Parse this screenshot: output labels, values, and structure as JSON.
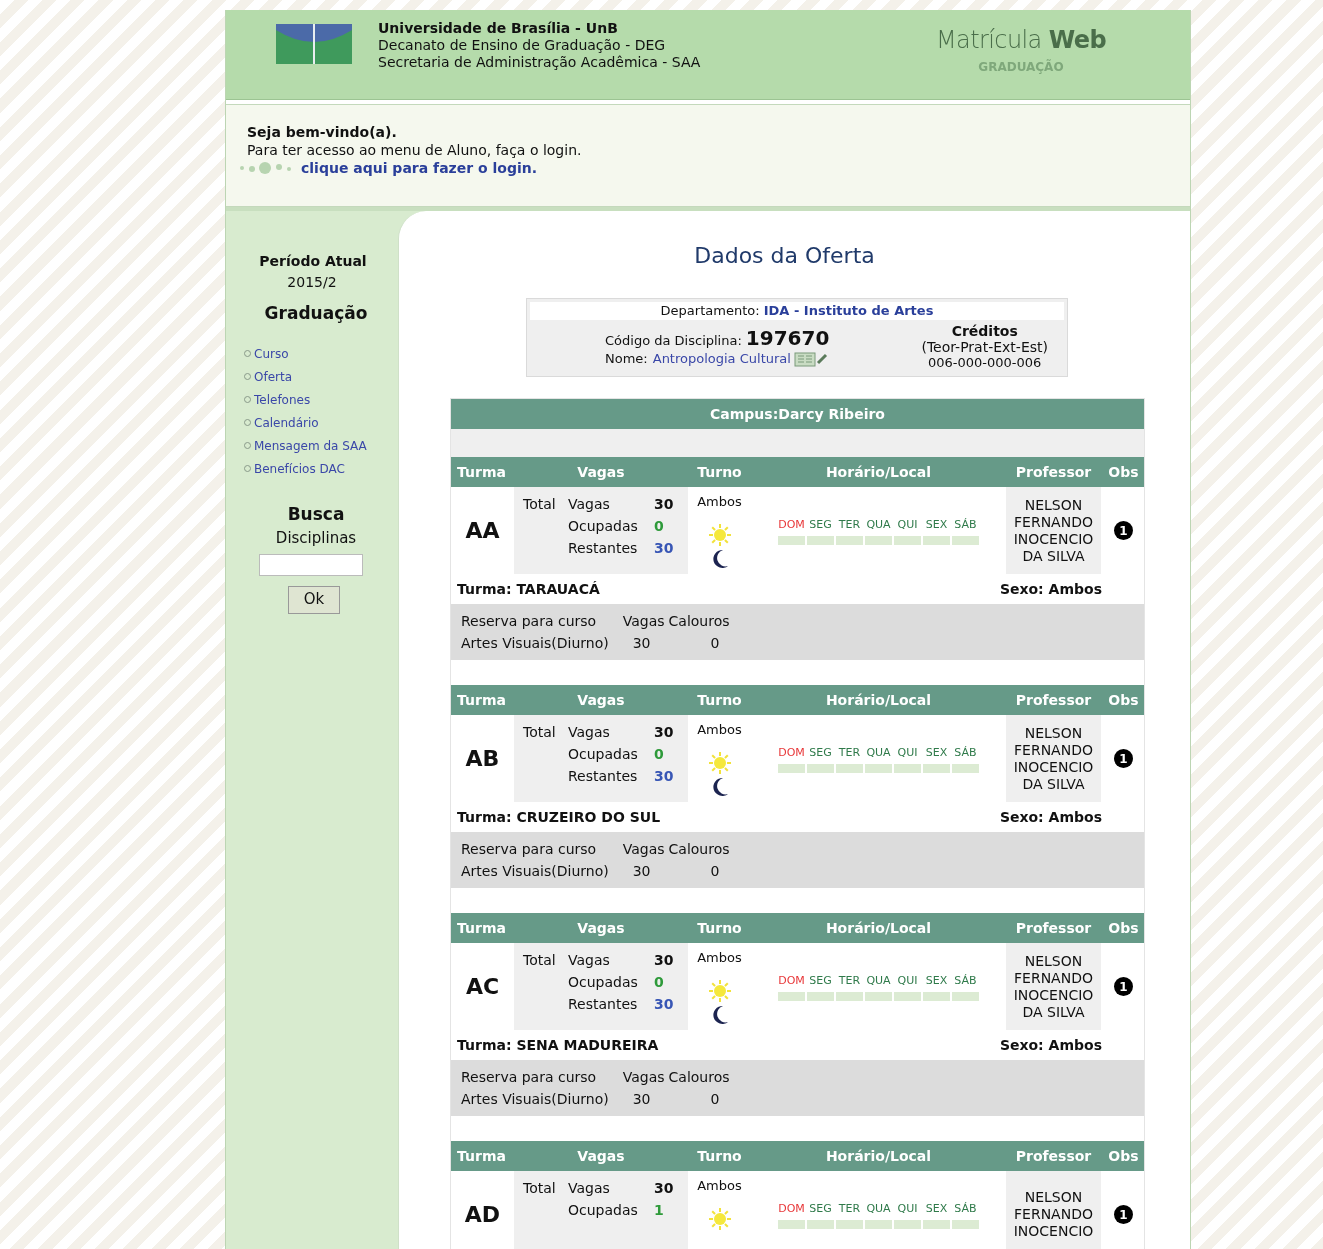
{
  "header": {
    "lines": [
      "Universidade de Brasília - UnB",
      "Decanato de Ensino de Graduação - DEG",
      "Secretaria de Administração Acadêmica - SAA"
    ],
    "brand_light": "Matrícula",
    "brand_bold": "Web",
    "brand_sub": "GRADUAÇÃO"
  },
  "welcome": {
    "title": "Seja bem-vindo(a).",
    "text": "Para ter acesso ao menu de Aluno, faça o login.",
    "link": "clique aqui para fazer o login."
  },
  "sidebar": {
    "period_label": "Período Atual",
    "period": "2015/2",
    "section": "Graduação",
    "items": [
      {
        "label": "Curso"
      },
      {
        "label": "Oferta"
      },
      {
        "label": "Telefones"
      },
      {
        "label": "Calendário"
      },
      {
        "label": "Mensagem da SAA"
      },
      {
        "label": "Benefícios DAC"
      }
    ],
    "search_title": "Busca",
    "search_sub": "Disciplinas",
    "search_button": "Ok"
  },
  "main": {
    "title": "Dados da Oferta",
    "dept_label": "Departamento:",
    "dept": "IDA - Instituto de Artes",
    "code_label": "Código da Disciplina:",
    "code": "197670",
    "name_label": "Nome:",
    "name": "Antropologia Cultural",
    "credits_title": "Créditos",
    "credits_sub": "(Teor-Prat-Ext-Est)",
    "credits": "006-000-000-006",
    "campus": "Campus:Darcy Ribeiro",
    "turmas": [
      {
        "columns": [
          "Turma",
          "Vagas",
          "Turno",
          "Horário/Local",
          "Professor",
          "Obs"
        ],
        "code": "AA",
        "total": "Total",
        "vagas_label": "Vagas",
        "vagas": "30",
        "ocupadas_label": "Ocupadas",
        "ocupadas": "0",
        "restantes_label": "Restantes",
        "restantes": "30",
        "turno": "Ambos",
        "sun": true,
        "moon": true,
        "days": [
          {
            "label": "DOM",
            "color": "#e8383a"
          },
          {
            "label": "SEG",
            "color": "#2f7a4a"
          },
          {
            "label": "TER",
            "color": "#2f7a4a"
          },
          {
            "label": "QUA",
            "color": "#2f7a4a"
          },
          {
            "label": "QUI",
            "color": "#2f7a4a"
          },
          {
            "label": "SEX",
            "color": "#2f7a4a"
          },
          {
            "label": "SÁB",
            "color": "#2f7a4a"
          }
        ],
        "professor": [
          "NELSON",
          "FERNANDO",
          "INOCENCIO",
          "DA SILVA"
        ],
        "obs": "1",
        "turma_name": "Turma: TARAUACÁ",
        "sexo": "Sexo: Ambos",
        "reserva_cols": [
          "Reserva para curso",
          "Vagas",
          "Calouros"
        ],
        "reserva_row": [
          "Artes Visuais(Diurno)",
          "30",
          "0"
        ]
      },
      {
        "columns": [
          "Turma",
          "Vagas",
          "Turno",
          "Horário/Local",
          "Professor",
          "Obs"
        ],
        "code": "AB",
        "total": "Total",
        "vagas_label": "Vagas",
        "vagas": "30",
        "ocupadas_label": "Ocupadas",
        "ocupadas": "0",
        "restantes_label": "Restantes",
        "restantes": "30",
        "turno": "Ambos",
        "sun": true,
        "moon": true,
        "days": [
          {
            "label": "DOM",
            "color": "#e8383a"
          },
          {
            "label": "SEG",
            "color": "#2f7a4a"
          },
          {
            "label": "TER",
            "color": "#2f7a4a"
          },
          {
            "label": "QUA",
            "color": "#2f7a4a"
          },
          {
            "label": "QUI",
            "color": "#2f7a4a"
          },
          {
            "label": "SEX",
            "color": "#2f7a4a"
          },
          {
            "label": "SÁB",
            "color": "#2f7a4a"
          }
        ],
        "professor": [
          "NELSON",
          "FERNANDO",
          "INOCENCIO",
          "DA SILVA"
        ],
        "obs": "1",
        "turma_name": "Turma: CRUZEIRO DO SUL",
        "sexo": "Sexo: Ambos",
        "reserva_cols": [
          "Reserva para curso",
          "Vagas",
          "Calouros"
        ],
        "reserva_row": [
          "Artes Visuais(Diurno)",
          "30",
          "0"
        ]
      },
      {
        "columns": [
          "Turma",
          "Vagas",
          "Turno",
          "Horário/Local",
          "Professor",
          "Obs"
        ],
        "code": "AC",
        "total": "Total",
        "vagas_label": "Vagas",
        "vagas": "30",
        "ocupadas_label": "Ocupadas",
        "ocupadas": "0",
        "restantes_label": "Restantes",
        "restantes": "30",
        "turno": "Ambos",
        "sun": true,
        "moon": true,
        "days": [
          {
            "label": "DOM",
            "color": "#e8383a"
          },
          {
            "label": "SEG",
            "color": "#2f7a4a"
          },
          {
            "label": "TER",
            "color": "#2f7a4a"
          },
          {
            "label": "QUA",
            "color": "#2f7a4a"
          },
          {
            "label": "QUI",
            "color": "#2f7a4a"
          },
          {
            "label": "SEX",
            "color": "#2f7a4a"
          },
          {
            "label": "SÁB",
            "color": "#2f7a4a"
          }
        ],
        "professor": [
          "NELSON",
          "FERNANDO",
          "INOCENCIO",
          "DA SILVA"
        ],
        "obs": "1",
        "turma_name": "Turma: SENA MADUREIRA",
        "sexo": "Sexo: Ambos",
        "reserva_cols": [
          "Reserva para curso",
          "Vagas",
          "Calouros"
        ],
        "reserva_row": [
          "Artes Visuais(Diurno)",
          "30",
          "0"
        ]
      },
      {
        "columns": [
          "Turma",
          "Vagas",
          "Turno",
          "Horário/Local",
          "Professor",
          "Obs"
        ],
        "code": "AD",
        "total": "Total",
        "vagas_label": "Vagas",
        "vagas": "30",
        "ocupadas_label": "Ocupadas",
        "ocupadas": "1",
        "turno": "Ambos",
        "sun": true,
        "moon": false,
        "days": [
          {
            "label": "DOM",
            "color": "#e8383a"
          },
          {
            "label": "SEG",
            "color": "#2f7a4a"
          },
          {
            "label": "TER",
            "color": "#2f7a4a"
          },
          {
            "label": "QUA",
            "color": "#2f7a4a"
          },
          {
            "label": "QUI",
            "color": "#2f7a4a"
          },
          {
            "label": "SEX",
            "color": "#2f7a4a"
          },
          {
            "label": "SÁB",
            "color": "#2f7a4a"
          }
        ],
        "professor": [
          "NELSON",
          "FERNANDO",
          "INOCENCIO"
        ],
        "obs": "1"
      }
    ]
  }
}
